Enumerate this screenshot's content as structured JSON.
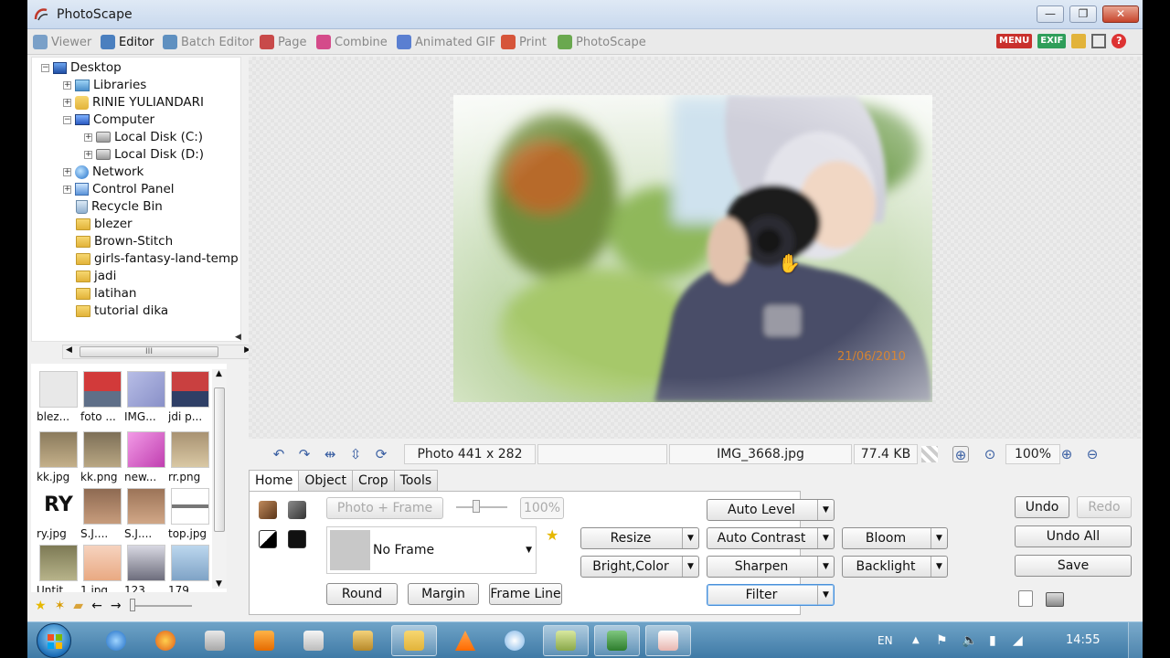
{
  "window": {
    "title": "PhotoScape",
    "minimize": "—",
    "maximize": "❐",
    "close": "✕"
  },
  "tabs": [
    {
      "label": "Viewer",
      "color": "#7aa0c8"
    },
    {
      "label": "Editor",
      "color": "#4a7fbf"
    },
    {
      "label": "Batch Editor",
      "color": "#5f90c0"
    },
    {
      "label": "Page",
      "color": "#c84a4a"
    },
    {
      "label": "Combine",
      "color": "#d44b8a"
    },
    {
      "label": "Animated GIF",
      "color": "#5a7fd1"
    },
    {
      "label": "Print",
      "color": "#d6553a"
    },
    {
      "label": "PhotoScape",
      "color": "#6aa84f"
    }
  ],
  "toolbar_right": {
    "menu_label": "MENU",
    "exif_label": "EXIF"
  },
  "tree": [
    {
      "label": "Desktop",
      "icon": "desk"
    },
    {
      "label": "Libraries",
      "icon": "lib"
    },
    {
      "label": "RINIE YULIANDARI",
      "icon": "user"
    },
    {
      "label": "Computer",
      "icon": "pc"
    },
    {
      "label": "Local Disk (C:)",
      "icon": "drive"
    },
    {
      "label": "Local Disk (D:)",
      "icon": "drive"
    },
    {
      "label": "Network",
      "icon": "globe"
    },
    {
      "label": "Control Panel",
      "icon": "panel"
    },
    {
      "label": "Recycle Bin",
      "icon": "bin"
    },
    {
      "label": "blezer",
      "icon": "folder"
    },
    {
      "label": "Brown-Stitch",
      "icon": "folder"
    },
    {
      "label": "girls-fantasy-land-temp",
      "icon": "folder"
    },
    {
      "label": "jadi",
      "icon": "folder"
    },
    {
      "label": "latihan",
      "icon": "folder"
    },
    {
      "label": "tutorial dika",
      "icon": "folder"
    }
  ],
  "thumbnails": [
    {
      "caption": "blez...",
      "color": "#e8e8e8"
    },
    {
      "caption": "foto ...",
      "color": "#d23a3a"
    },
    {
      "caption": "IMG...",
      "color": "#9fa7d8"
    },
    {
      "caption": "jdi p...",
      "color": "#c94040"
    },
    {
      "caption": "kk.jpg",
      "color": "#8a7a5c"
    },
    {
      "caption": "kk.png",
      "color": "#7d6f57"
    },
    {
      "caption": "new...",
      "color": "#e06fd0"
    },
    {
      "caption": "rr.png",
      "color": "#a89272"
    },
    {
      "caption": "ry.jpg",
      "color": "#111111"
    },
    {
      "caption": "S.J....",
      "color": "#8e6a52"
    },
    {
      "caption": "S.J....",
      "color": "#9c7458"
    },
    {
      "caption": "top.jpg",
      "color": "#dcdcdc"
    },
    {
      "caption": "Untit...",
      "color": "#7d7a55"
    },
    {
      "caption": "1.jpg",
      "color": "#e9a982"
    },
    {
      "caption": "123...",
      "color": "#6d6d7c"
    },
    {
      "caption": "179...",
      "color": "#7fa3c6"
    }
  ],
  "thumb_label": "RY",
  "hscroll_grip": "III",
  "info": {
    "size": "Photo 441 x 282",
    "blank": "",
    "filename": "IMG_3668.jpg",
    "filesize": "77.4 KB",
    "zoom": "100%"
  },
  "photo_date": "21/06/2010",
  "editor_tabs": [
    "Home",
    "Object",
    "Crop",
    "Tools"
  ],
  "home": {
    "photo_frame": "Photo + Frame",
    "opacity": "100%",
    "frame_select": "No Frame",
    "round": "Round",
    "margin": "Margin",
    "frame_line": "Frame Line",
    "auto_level": "Auto Level",
    "resize": "Resize",
    "auto_contrast": "Auto Contrast",
    "bloom": "Bloom",
    "bright_color": "Bright,Color",
    "sharpen": "Sharpen",
    "backlight": "Backlight",
    "filter": "Filter",
    "undo": "Undo",
    "redo": "Redo",
    "undo_all": "Undo All",
    "save": "Save"
  },
  "taskbar": {
    "lang": "EN",
    "time": "14:55"
  },
  "colors": {
    "accent": "#4a90d9",
    "menu_badge": "#c9302c",
    "exif_badge": "#2f9e5a"
  }
}
